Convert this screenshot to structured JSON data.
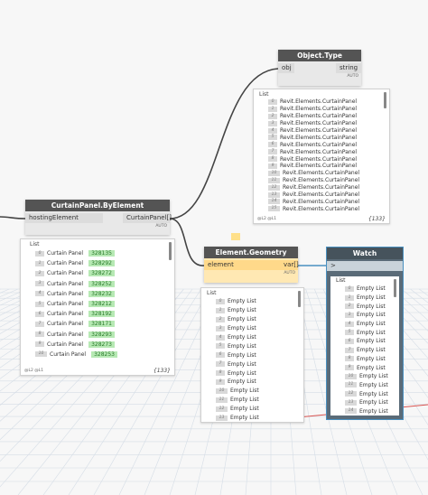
{
  "object_type": {
    "title": "Object.Type",
    "input": "obj",
    "output": "string",
    "footer": "AUTO",
    "preview": {
      "label": "List",
      "items": [
        {
          "index": "0",
          "text": "Revit.Elements.CurtainPanel"
        },
        {
          "index": "1",
          "text": "Revit.Elements.CurtainPanel"
        },
        {
          "index": "2",
          "text": "Revit.Elements.CurtainPanel"
        },
        {
          "index": "3",
          "text": "Revit.Elements.CurtainPanel"
        },
        {
          "index": "4",
          "text": "Revit.Elements.CurtainPanel"
        },
        {
          "index": "5",
          "text": "Revit.Elements.CurtainPanel"
        },
        {
          "index": "6",
          "text": "Revit.Elements.CurtainPanel"
        },
        {
          "index": "7",
          "text": "Revit.Elements.CurtainPanel"
        },
        {
          "index": "8",
          "text": "Revit.Elements.CurtainPanel"
        },
        {
          "index": "9",
          "text": "Revit.Elements.CurtainPanel"
        },
        {
          "index": "10",
          "text": "Revit.Elements.CurtainPanel"
        },
        {
          "index": "11",
          "text": "Revit.Elements.CurtainPanel"
        },
        {
          "index": "12",
          "text": "Revit.Elements.CurtainPanel"
        },
        {
          "index": "13",
          "text": "Revit.Elements.CurtainPanel"
        },
        {
          "index": "14",
          "text": "Revit.Elements.CurtainPanel"
        },
        {
          "index": "15",
          "text": "Revit.Elements.CurtainPanel"
        }
      ],
      "levels": "@L2 @L1",
      "count": "{133}"
    }
  },
  "curtain_panel": {
    "title": "CurtainPanel.ByElement",
    "input": "hostingElement",
    "output": "CurtainPanel[]",
    "footer": "AUTO",
    "preview": {
      "label": "List",
      "items": [
        {
          "index": "0",
          "text": "Curtain Panel",
          "id": "328135"
        },
        {
          "index": "1",
          "text": "Curtain Panel",
          "id": "328292"
        },
        {
          "index": "2",
          "text": "Curtain Panel",
          "id": "328272"
        },
        {
          "index": "3",
          "text": "Curtain Panel",
          "id": "328252"
        },
        {
          "index": "4",
          "text": "Curtain Panel",
          "id": "328232"
        },
        {
          "index": "5",
          "text": "Curtain Panel",
          "id": "328212"
        },
        {
          "index": "6",
          "text": "Curtain Panel",
          "id": "328192"
        },
        {
          "index": "7",
          "text": "Curtain Panel",
          "id": "328171"
        },
        {
          "index": "8",
          "text": "Curtain Panel",
          "id": "328293"
        },
        {
          "index": "9",
          "text": "Curtain Panel",
          "id": "328273"
        },
        {
          "index": "10",
          "text": "Curtain Panel",
          "id": "328253"
        }
      ],
      "levels": "@L2 @L1",
      "count": "{133}"
    }
  },
  "element_geometry": {
    "title": "Element.Geometry",
    "input": "element",
    "output": "var[]",
    "footer": "AUTO",
    "preview": {
      "label": "List",
      "items": [
        {
          "index": "0",
          "text": "Empty List"
        },
        {
          "index": "1",
          "text": "Empty List"
        },
        {
          "index": "2",
          "text": "Empty List"
        },
        {
          "index": "3",
          "text": "Empty List"
        },
        {
          "index": "4",
          "text": "Empty List"
        },
        {
          "index": "5",
          "text": "Empty List"
        },
        {
          "index": "6",
          "text": "Empty List"
        },
        {
          "index": "7",
          "text": "Empty List"
        },
        {
          "index": "8",
          "text": "Empty List"
        },
        {
          "index": "9",
          "text": "Empty List"
        },
        {
          "index": "10",
          "text": "Empty List"
        },
        {
          "index": "11",
          "text": "Empty List"
        },
        {
          "index": "12",
          "text": "Empty List"
        },
        {
          "index": "13",
          "text": "Empty List"
        }
      ]
    }
  },
  "watch": {
    "title": "Watch",
    "input": ">",
    "label": "List",
    "items": [
      {
        "index": "0",
        "text": "Empty List"
      },
      {
        "index": "1",
        "text": "Empty List"
      },
      {
        "index": "2",
        "text": "Empty List"
      },
      {
        "index": "3",
        "text": "Empty List"
      },
      {
        "index": "4",
        "text": "Empty List"
      },
      {
        "index": "5",
        "text": "Empty List"
      },
      {
        "index": "6",
        "text": "Empty List"
      },
      {
        "index": "7",
        "text": "Empty List"
      },
      {
        "index": "8",
        "text": "Empty List"
      },
      {
        "index": "9",
        "text": "Empty List"
      },
      {
        "index": "10",
        "text": "Empty List"
      },
      {
        "index": "11",
        "text": "Empty List"
      },
      {
        "index": "12",
        "text": "Empty List"
      },
      {
        "index": "13",
        "text": "Empty List"
      },
      {
        "index": "14",
        "text": "Empty List"
      }
    ]
  },
  "colors": {
    "node_title": "#545454",
    "geometry_body": "#ffe8b3",
    "watch_border": "#4a90c0",
    "id_badge": "#b7e9b4",
    "wire": "#444444",
    "watch_wire": "#4a90c0"
  }
}
